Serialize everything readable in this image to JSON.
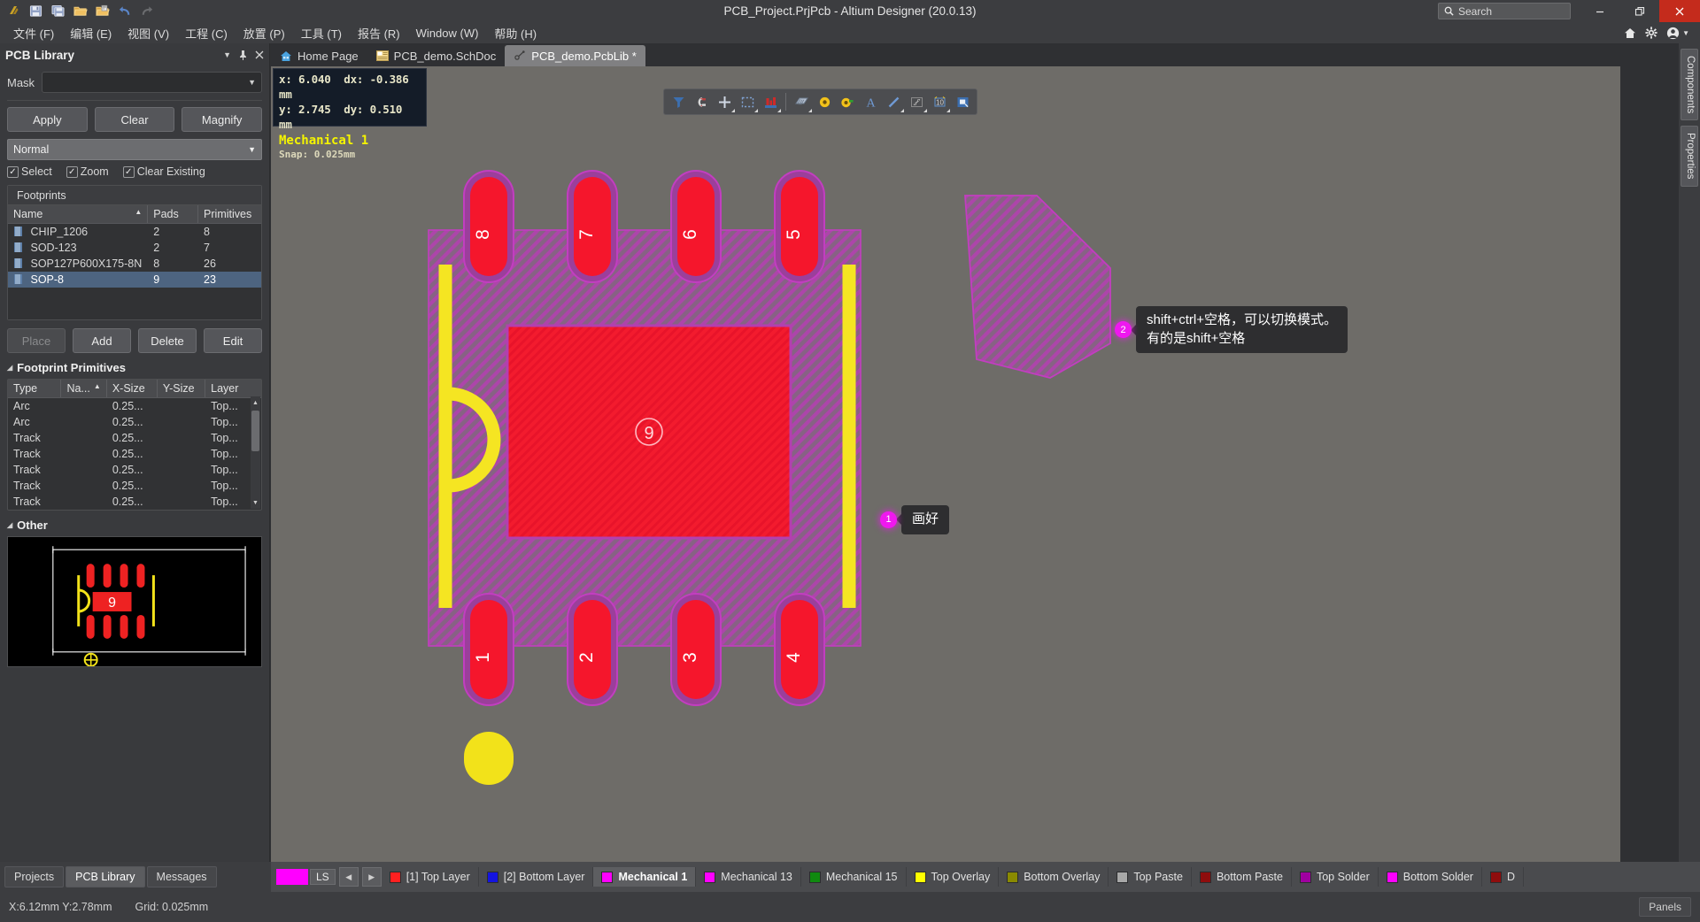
{
  "window": {
    "title": "PCB_Project.PrjPcb - Altium Designer (20.0.13)",
    "search_placeholder": "Search",
    "minimize": "–",
    "restore": "❐",
    "close": "✕"
  },
  "quick_access": [
    {
      "name": "altium-logo-icon",
      "label": "A"
    },
    {
      "name": "save-icon",
      "label": "Save"
    },
    {
      "name": "save-all-icon",
      "label": "Save All"
    },
    {
      "name": "open-icon",
      "label": "Open"
    },
    {
      "name": "open-project-icon",
      "label": "Open Project"
    },
    {
      "name": "undo-icon",
      "label": "Undo"
    },
    {
      "name": "redo-icon",
      "label": "Redo"
    }
  ],
  "menu": [
    {
      "label": "文件 (F)"
    },
    {
      "label": "编辑 (E)"
    },
    {
      "label": "视图 (V)"
    },
    {
      "label": "工程 (C)"
    },
    {
      "label": "放置 (P)"
    },
    {
      "label": "工具 (T)"
    },
    {
      "label": "报告 (R)"
    },
    {
      "label": "Window (W)"
    },
    {
      "label": "帮助 (H)"
    }
  ],
  "menu_right_icons": [
    "home-icon",
    "gear-icon",
    "user-account-icon"
  ],
  "panel": {
    "title": "PCB Library",
    "controls": [
      "chevron-down-icon",
      "pin-icon",
      "close-icon"
    ],
    "mask_label": "Mask",
    "mask_value": "",
    "buttons": {
      "apply": "Apply",
      "clear": "Clear",
      "magnify": "Magnify"
    },
    "mode_value": "Normal",
    "checkboxes": [
      {
        "label": "Select",
        "checked": true
      },
      {
        "label": "Zoom",
        "checked": true
      },
      {
        "label": "Clear Existing",
        "checked": true
      }
    ],
    "footprints": {
      "group_title": "Footprints",
      "columns": [
        "Name",
        "Pads",
        "Primitives"
      ],
      "sort_column": "Name",
      "sort_dir": "asc",
      "rows": [
        {
          "name": "CHIP_1206",
          "pads": "2",
          "primitives": "8",
          "selected": false
        },
        {
          "name": "SOD-123",
          "pads": "2",
          "primitives": "7",
          "selected": false
        },
        {
          "name": "SOP127P600X175-8N",
          "pads": "8",
          "primitives": "26",
          "selected": false
        },
        {
          "name": "SOP-8",
          "pads": "9",
          "primitives": "23",
          "selected": true
        }
      ]
    },
    "action_buttons": {
      "place": "Place",
      "add": "Add",
      "delete": "Delete",
      "edit": "Edit"
    },
    "primitives": {
      "section_title": "Footprint Primitives",
      "columns": [
        "Type",
        "Na...",
        "X-Size",
        "Y-Size",
        "Layer"
      ],
      "sort_column": "Na...",
      "rows": [
        {
          "type": "Arc",
          "na": "",
          "xsize": "0.25...",
          "ysize": "",
          "layer": "Top..."
        },
        {
          "type": "Arc",
          "na": "",
          "xsize": "0.25...",
          "ysize": "",
          "layer": "Top..."
        },
        {
          "type": "Track",
          "na": "",
          "xsize": "0.25...",
          "ysize": "",
          "layer": "Top..."
        },
        {
          "type": "Track",
          "na": "",
          "xsize": "0.25...",
          "ysize": "",
          "layer": "Top..."
        },
        {
          "type": "Track",
          "na": "",
          "xsize": "0.25...",
          "ysize": "",
          "layer": "Top..."
        },
        {
          "type": "Track",
          "na": "",
          "xsize": "0.25...",
          "ysize": "",
          "layer": "Top..."
        },
        {
          "type": "Track",
          "na": "",
          "xsize": "0.25...",
          "ysize": "",
          "layer": "Top..."
        }
      ]
    },
    "other": {
      "section_title": "Other",
      "preview_pad_label": "9"
    }
  },
  "doc_tabs": [
    {
      "label": "Home Page",
      "icon": "home-icon",
      "active": false,
      "modified": false
    },
    {
      "label": "PCB_demo.SchDoc",
      "icon": "schematic-icon",
      "active": false,
      "modified": false
    },
    {
      "label": "PCB_demo.PcbLib *",
      "icon": "pcblib-icon",
      "active": true,
      "modified": true
    }
  ],
  "coord_overlay": {
    "x_label": "x:",
    "x_value": "6.040",
    "dx_label": "dx:",
    "dx_value": "-0.386 mm",
    "y_label": "y:",
    "y_value": "2.745",
    "dy_label": "dy:",
    "dy_value": "0.510 mm",
    "layer_name": "Mechanical 1",
    "snap": "Snap: 0.025mm"
  },
  "tool_palette": [
    {
      "name": "filter-icon",
      "dropdown": false
    },
    {
      "name": "magnet-icon",
      "dropdown": false
    },
    {
      "name": "crosshair-place-icon",
      "dropdown": true
    },
    {
      "name": "selection-rect-icon",
      "dropdown": true
    },
    {
      "name": "board-cutout-icon",
      "dropdown": true
    },
    {
      "name": "polygon-pour-icon",
      "dropdown": true
    },
    {
      "name": "pad-icon",
      "dropdown": false
    },
    {
      "name": "via-icon",
      "dropdown": false
    },
    {
      "name": "text-string-icon",
      "dropdown": false
    },
    {
      "name": "line-icon",
      "dropdown": true
    },
    {
      "name": "dimension-icon",
      "dropdown": true
    },
    {
      "name": "coordinate-icon",
      "dropdown": true
    },
    {
      "name": "embedded-board-icon",
      "dropdown": false
    }
  ],
  "annotations": [
    {
      "number": "1",
      "text": "画好"
    },
    {
      "number": "2",
      "text": "shift+ctrl+空格，可以切换模式。\n有的是shift+空格"
    }
  ],
  "pcb": {
    "pad_numbers_top": [
      "8",
      "7",
      "6",
      "5"
    ],
    "pad_numbers_bottom": [
      "1",
      "2",
      "3",
      "4"
    ],
    "center_pad_number": "9"
  },
  "right_rail": [
    {
      "label": "Components"
    },
    {
      "label": "Properties"
    }
  ],
  "layer_bar": {
    "ls_label": "LS",
    "ls_color": "#ff00ff",
    "prev": "◀",
    "next": "▶",
    "layers": [
      {
        "label": "[1] Top Layer",
        "color": "#ff2020",
        "active": false
      },
      {
        "label": "[2] Bottom Layer",
        "color": "#1414e0",
        "active": false
      },
      {
        "label": "Mechanical 1",
        "color": "#ff00ff",
        "active": true
      },
      {
        "label": "Mechanical 13",
        "color": "#ff00ff",
        "active": false
      },
      {
        "label": "Mechanical 15",
        "color": "#0f8a0f",
        "active": false
      },
      {
        "label": "Top Overlay",
        "color": "#ffff00",
        "active": false
      },
      {
        "label": "Bottom Overlay",
        "color": "#8a8a00",
        "active": false
      },
      {
        "label": "Top Paste",
        "color": "#a8a8a8",
        "active": false
      },
      {
        "label": "Bottom Paste",
        "color": "#8f0d0d",
        "active": false
      },
      {
        "label": "Top Solder",
        "color": "#a000a0",
        "active": false
      },
      {
        "label": "Bottom Solder",
        "color": "#ff00ff",
        "active": false
      },
      {
        "label": "D",
        "color": "#8f0d0d",
        "active": false
      }
    ]
  },
  "bottom_panel_tabs": [
    {
      "label": "Projects",
      "active": false
    },
    {
      "label": "PCB Library",
      "active": true
    },
    {
      "label": "Messages",
      "active": false
    }
  ],
  "status_bar": {
    "coords": "X:6.12mm Y:2.78mm",
    "grid": "Grid: 0.025mm",
    "panels_button": "Panels"
  }
}
